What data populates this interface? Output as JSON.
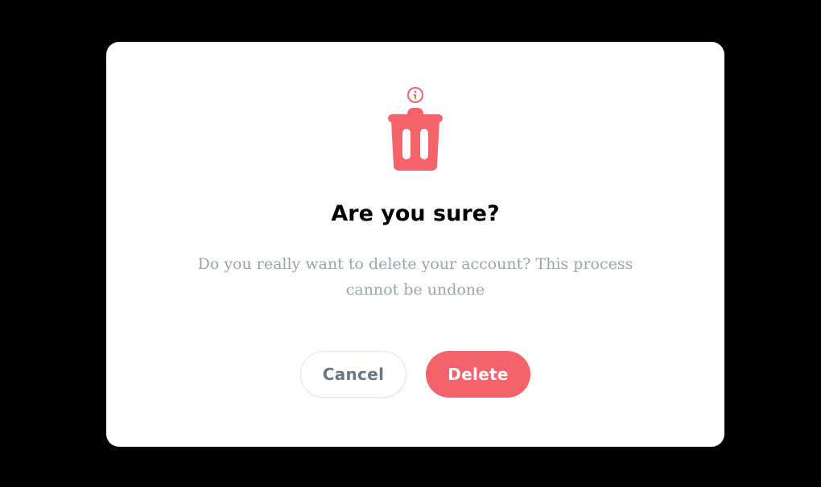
{
  "dialog": {
    "title": "Are you sure?",
    "message": "Do you really want to delete your account? This process cannot be undone",
    "icon": "trash-icon",
    "info_icon": "info-circle-icon"
  },
  "actions": {
    "cancel_label": "Cancel",
    "delete_label": "Delete"
  },
  "colors": {
    "backdrop": "#000000",
    "danger": "#f5636a",
    "message_text": "#9aa5b1",
    "cancel_text": "#6b7585"
  }
}
